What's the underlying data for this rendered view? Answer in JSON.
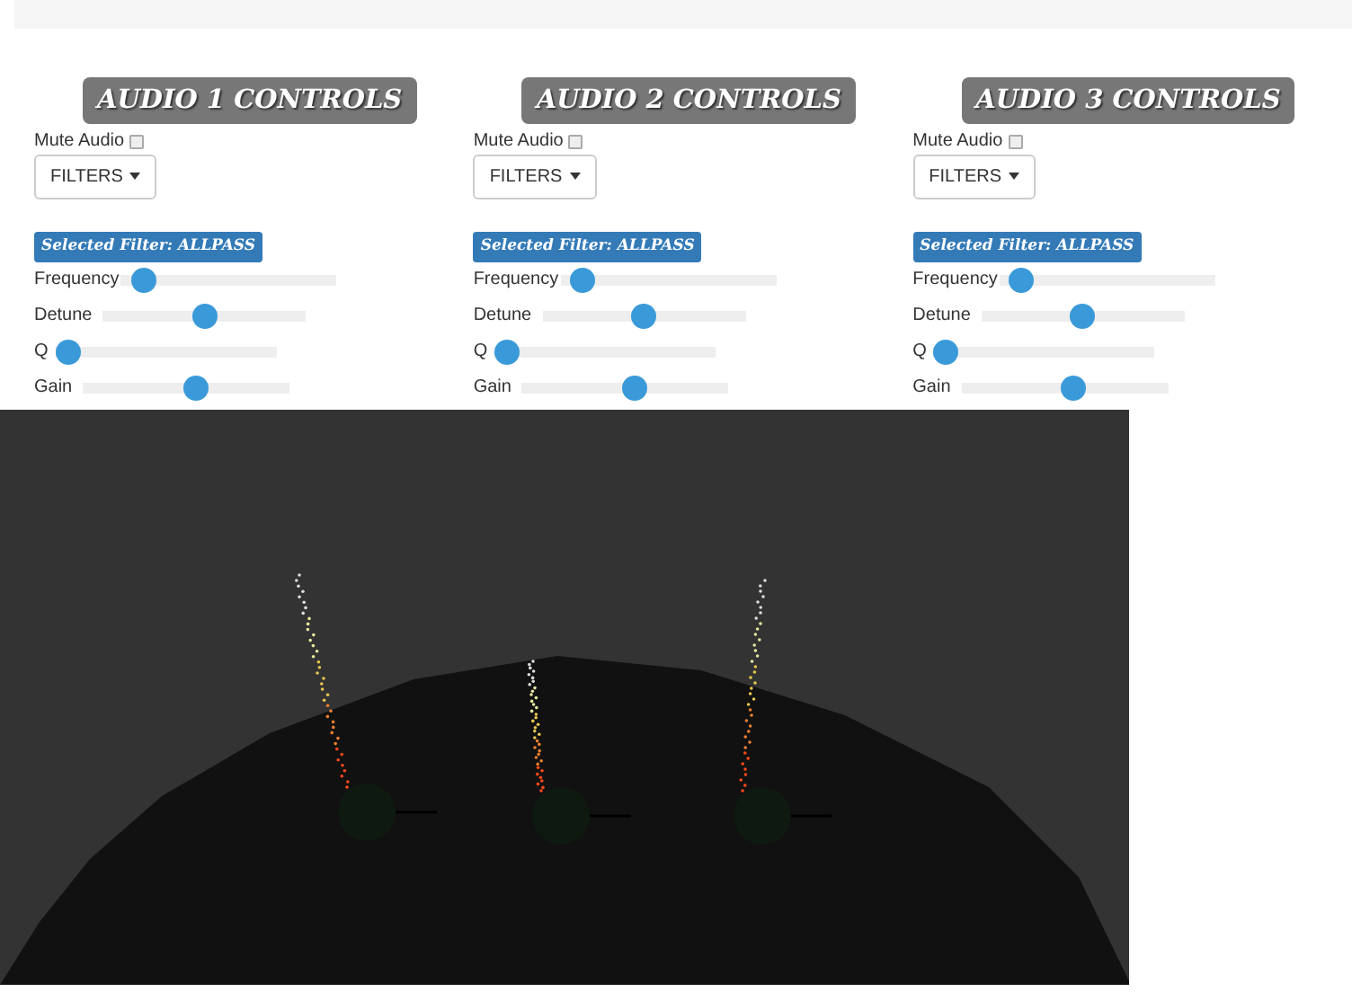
{
  "panels": [
    {
      "title": "AUDIO 1 CONTROLS",
      "mute_label": "Mute Audio",
      "muted": false,
      "filter_button": "FILTERS",
      "selected_filter": "Selected Filter: ALLPASS",
      "sliders": [
        {
          "label": "Frequency",
          "level": 0.05
        },
        {
          "label": "Detune",
          "level": 0.5
        },
        {
          "label": "Q",
          "level": 0.0
        },
        {
          "label": "Gain",
          "level": 0.55
        }
      ]
    },
    {
      "title": "AUDIO 2 CONTROLS",
      "mute_label": "Mute Audio",
      "muted": false,
      "filter_button": "FILTERS",
      "selected_filter": "Selected Filter: ALLPASS",
      "sliders": [
        {
          "label": "Frequency",
          "level": 0.05
        },
        {
          "label": "Detune",
          "level": 0.5
        },
        {
          "label": "Q",
          "level": 0.0
        },
        {
          "label": "Gain",
          "level": 0.55
        }
      ]
    },
    {
      "title": "AUDIO 3 CONTROLS",
      "mute_label": "Mute Audio",
      "muted": false,
      "filter_button": "FILTERS",
      "selected_filter": "Selected Filter: ALLPASS",
      "sliders": [
        {
          "label": "Frequency",
          "level": 0.05
        },
        {
          "label": "Detune",
          "level": 0.5
        },
        {
          "label": "Q",
          "level": 0.0
        },
        {
          "label": "Gain",
          "level": 0.55
        }
      ]
    }
  ]
}
